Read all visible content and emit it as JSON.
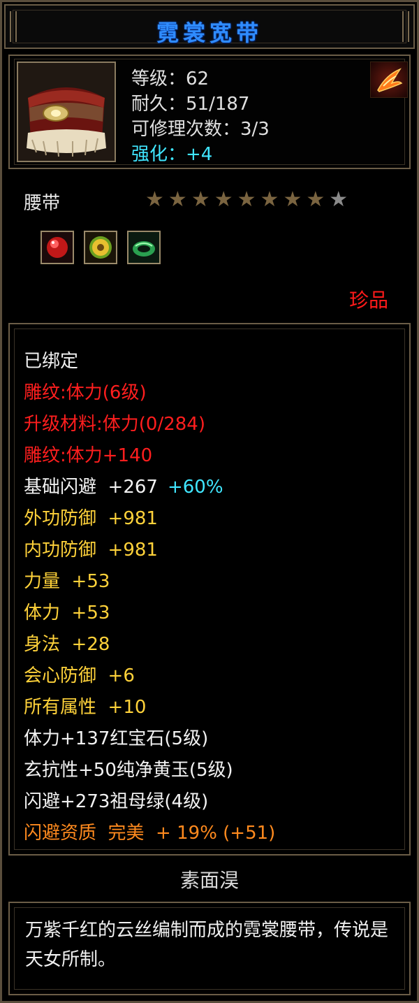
{
  "window": {
    "title": "霓裳宽带"
  },
  "item": {
    "icon": "belt-item-icon",
    "stats": {
      "level": "等级：62",
      "durability": "耐久：51/187",
      "repairs": "可修理次数：3/3",
      "enhance": "强化：+4"
    },
    "craft_icon": "crafted-mark-icon",
    "type": "腰带",
    "stars_filled": 8,
    "stars_total": 9,
    "gems": [
      "ruby-gem-icon",
      "yellow-jade-gem-icon",
      "emerald-gem-icon"
    ],
    "rarity": "珍品"
  },
  "attributes": [
    {
      "text": "已绑定",
      "color": "white"
    },
    {
      "text": "雕纹:体力(6级)",
      "color": "red"
    },
    {
      "text": "升级材料:体力(0/284)",
      "color": "red"
    },
    {
      "text": "雕纹:体力+140",
      "color": "red"
    },
    {
      "text": "基础闪避  +267",
      "color": "white",
      "extra": "+60%",
      "extra_color": "cyan"
    },
    {
      "text": "外功防御  +981",
      "color": "yellow"
    },
    {
      "text": "内功防御  +981",
      "color": "yellow"
    },
    {
      "text": "力量  +53",
      "color": "yellow"
    },
    {
      "text": "体力  +53",
      "color": "yellow"
    },
    {
      "text": "身法  +28",
      "color": "yellow"
    },
    {
      "text": "会心防御  +6",
      "color": "yellow"
    },
    {
      "text": "所有属性  +10",
      "color": "yellow"
    },
    {
      "text": "体力+137红宝石(5级)",
      "color": "white"
    },
    {
      "text": "玄抗性+50纯净黄玉(5级)",
      "color": "white"
    },
    {
      "text": "闪避+273祖母绿(4级)",
      "color": "white"
    },
    {
      "text": "闪避资质  完美  + 19% (+51)",
      "color": "orange"
    }
  ],
  "set_name": "素面淏",
  "description": "万紫千红的云丝编制而成的霓裳腰带，传说是天女所制。",
  "colors": {
    "title": "#2f8cff",
    "white": "#f2f2f2",
    "red": "#ff1e1e",
    "yellow": "#ffd23a",
    "orange": "#ff8a1e",
    "cyan": "#40e6ff",
    "rarity": "#ff1a1a",
    "border": "#6b5d47"
  }
}
